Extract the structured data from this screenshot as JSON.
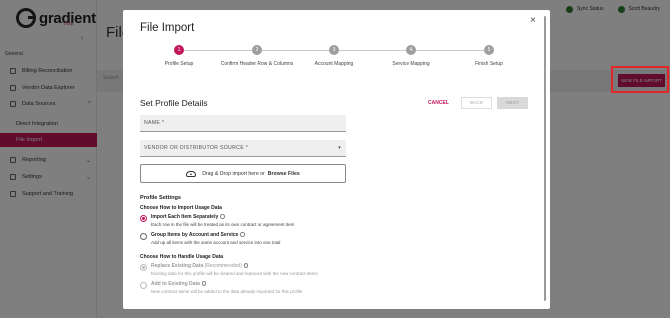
{
  "app": {
    "logo_text": "gradient",
    "logo_sub": "msp",
    "page_title": "File",
    "nav_heading": "General",
    "nav": [
      {
        "label": "Billing Reconciliation"
      },
      {
        "label": "Vendor Data Explorer"
      },
      {
        "label": "Data Sources"
      },
      {
        "label": "Direct Integration"
      },
      {
        "label": "File Import"
      },
      {
        "label": "Reporting"
      },
      {
        "label": "Settings"
      },
      {
        "label": "Support and Training"
      }
    ],
    "topbar": {
      "sync_status": "Sync Status",
      "user": "Scott Beaudry"
    },
    "search_placeholder": "Search",
    "new_file_import": "NEW FILE IMPORT"
  },
  "modal": {
    "title": "File Import",
    "close": "×",
    "steps": [
      {
        "num": "1",
        "label": "Profile Setup",
        "active": true
      },
      {
        "num": "2",
        "label": "Confirm Header Row & Columns",
        "active": false
      },
      {
        "num": "3",
        "label": "Account Mapping",
        "active": false
      },
      {
        "num": "4",
        "label": "Service Mapping",
        "active": false
      },
      {
        "num": "5",
        "label": "Finish Setup",
        "active": false
      }
    ],
    "section_title": "Set Profile Details",
    "cancel": "CANCEL",
    "back": "BACK",
    "next": "NEXT",
    "name_placeholder": "NAME *",
    "vendor_placeholder": "VENDOR OR DISTRIBUTOR SOURCE *",
    "upload": {
      "prefix": "Drag & Drop import here or",
      "link": "Browse Files"
    },
    "profile_settings": "Profile Settings",
    "usage_heading": "Choose How to Import Usage Data",
    "usage_options": [
      {
        "label": "Import Each Item Separately",
        "desc": "Each row in the file will be treated as its own contract or agreement item",
        "checked": true
      },
      {
        "label": "Group Items by Account and Service",
        "desc": "Add up all items with the same account and service into one total",
        "checked": false
      }
    ],
    "handle_heading": "Choose How to Handle Usage Data",
    "handle_options": [
      {
        "label": "Replace Existing Data",
        "suffix": " (Recommended)",
        "desc": "Existing data for this profile will be cleared and replaced with the new contract items",
        "checked": true
      },
      {
        "label": "Add to Existing Data",
        "suffix": "",
        "desc": "New contract items will be added to the data already imported for this profile",
        "checked": false
      }
    ]
  },
  "colors": {
    "accent": "#c2185b",
    "highlight": "#e3262c"
  }
}
